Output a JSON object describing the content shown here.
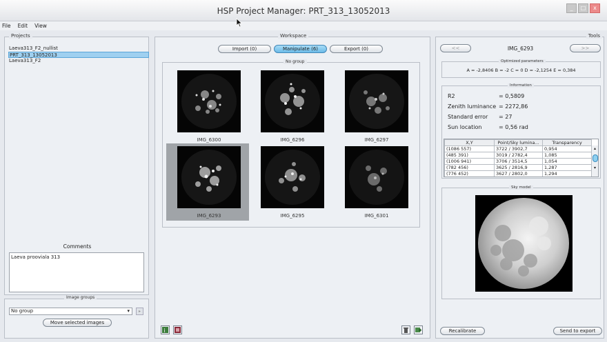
{
  "window": {
    "title": "HSP Project Manager: PRT_313_13052013",
    "minimize": "_",
    "maximize": "□",
    "close": "x"
  },
  "menu": [
    "File",
    "Edit",
    "View"
  ],
  "projects": {
    "legend": "Projects",
    "items": [
      "Laeva313_F2_nullist",
      "PRT_313_13052013",
      "Laeva313_F2"
    ],
    "selected_index": 1
  },
  "comments": {
    "label": "Comments",
    "text": "Laeva prooviala 313"
  },
  "image_groups": {
    "legend": "Image groups",
    "select_value": "No group",
    "move_button": "Move selected images"
  },
  "workspace": {
    "legend": "Workspace",
    "tabs": [
      "Import (0)",
      "Manipulate (6)",
      "Export (0)"
    ],
    "active_tab": 1,
    "group_legend": "No group",
    "images": [
      "IMG_6300",
      "IMG_6296",
      "IMG_6297",
      "IMG_6293",
      "IMG_6295",
      "IMG_6301"
    ],
    "selected_image": 3
  },
  "tools": {
    "legend": "Tools",
    "prev": "<<",
    "next": ">>",
    "current_image": "IMG_6293",
    "optimized_legend": "Optimized parameters",
    "optimized_text": "A = -2,8406 B = -2 C = 0 D = -2,1254 E = 0,384",
    "information_legend": "Information",
    "info": [
      {
        "key": "R2",
        "value": "= 0,5809"
      },
      {
        "key": "Zenith luminance",
        "value": "= 2272,86"
      },
      {
        "key": "Standard error",
        "value": "= 27"
      },
      {
        "key": "Sun location",
        "value": "= 0,56 rad"
      }
    ],
    "table": {
      "headers": [
        "X,Y",
        "Point/Sky lumina...",
        "Transparency"
      ],
      "rows": [
        [
          "(1086 557)",
          "3722 / 3902,7",
          "0,954"
        ],
        [
          "(485 391)",
          "3019 / 2782,4",
          "1,085"
        ],
        [
          "(1006 941)",
          "3706 / 3514,5",
          "1,054"
        ],
        [
          "(782 456)",
          "3625 / 2816,9",
          "1,287"
        ],
        [
          "(776 452)",
          "3627 / 2802,0",
          "1,294"
        ]
      ]
    },
    "sky_model_legend": "Sky model",
    "recalibrate": "Recalibrate",
    "send_to_export": "Send to export"
  },
  "colors": {
    "selection": "#9fd0f0",
    "active_tab": "#6cbbe8",
    "background": "#e6e9ee"
  }
}
